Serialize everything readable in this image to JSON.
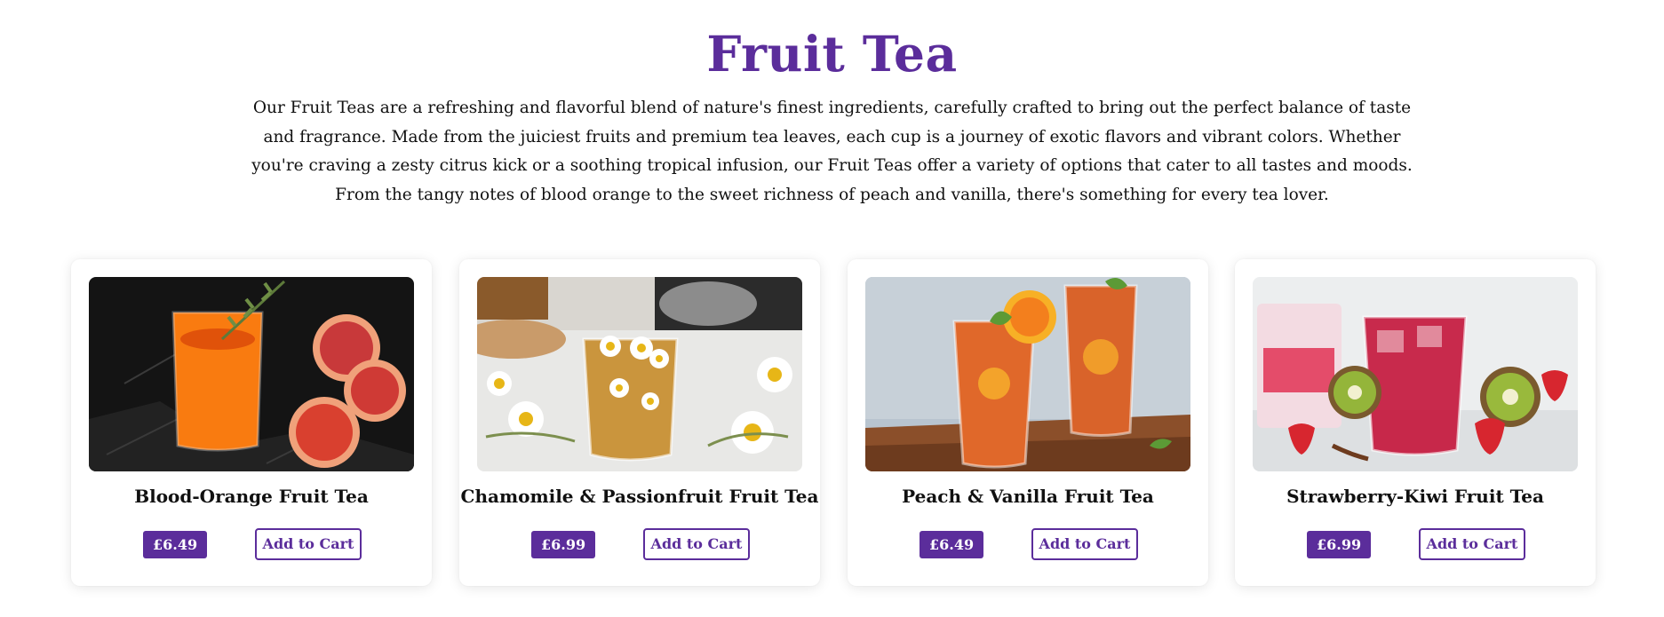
{
  "header": {
    "title": "Fruit Tea",
    "intro": "Our Fruit Teas are a refreshing and flavorful blend of nature's finest ingredients, carefully crafted to bring out the perfect balance of taste and fragrance. Made from the juiciest fruits and premium tea leaves, each cup is a journey of exotic flavors and vibrant colors. Whether you're craving a zesty citrus kick or a soothing tropical infusion, our Fruit Teas offer a variety of options that cater to all tastes and moods. From the tangy notes of blood orange to the sweet richness of peach and vanilla, there's something for every tea lover."
  },
  "colors": {
    "accent": "#5b2d9b"
  },
  "products": [
    {
      "name": "Blood-Orange Fruit Tea",
      "price": "£6.49",
      "button_label": "Add to Cart"
    },
    {
      "name": "Chamomile & Passionfruit Fruit Tea",
      "price": "£6.99",
      "button_label": "Add to Cart"
    },
    {
      "name": "Peach & Vanilla Fruit Tea",
      "price": "£6.49",
      "button_label": "Add to Cart"
    },
    {
      "name": "Strawberry-Kiwi Fruit Tea",
      "price": "£6.99",
      "button_label": "Add to Cart"
    }
  ]
}
